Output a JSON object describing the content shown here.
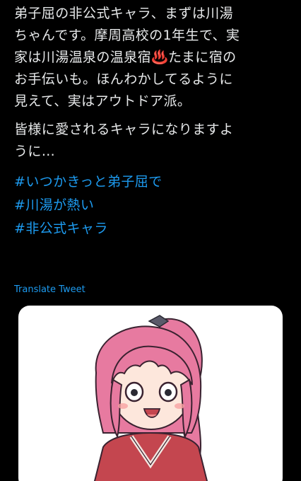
{
  "tweet": {
    "paragraph1": [
      "弟子屈の非公式キャラ、まずは川湯",
      "ちゃんです。摩周高校の1年生で、実",
      "家は川湯温泉の温泉宿♨️たまに宿の",
      "お手伝いも。ほんわかしてるように",
      "見えて、実はアウトドア派。"
    ],
    "paragraph2": [
      "皆様に愛されるキャラになりますよ",
      "うに…"
    ],
    "hashtags": [
      "#いつかきっと弟子屈で",
      "#川湯が熱い",
      "#非公式キャラ"
    ],
    "translate_label": "Translate Tweet"
  },
  "colors": {
    "background": "#000000",
    "text": "#e7e9ea",
    "link": "#1d9bf0",
    "card": "#ffffff"
  },
  "media": {
    "icon": "anime-girl-illustration"
  }
}
